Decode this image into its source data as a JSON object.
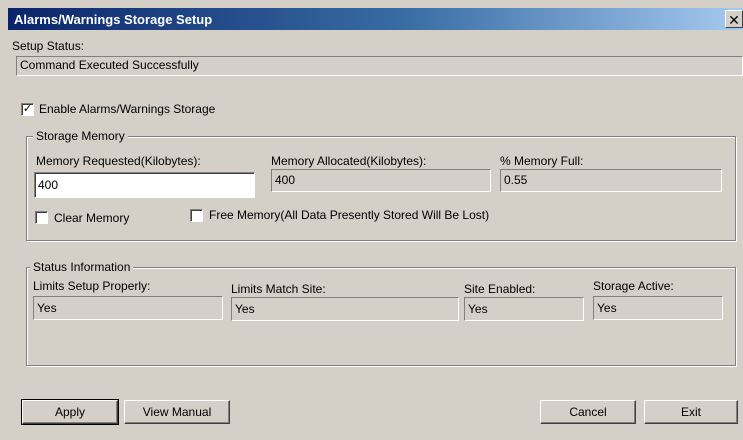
{
  "window": {
    "title": "Alarms/Warnings Storage Setup",
    "close_glyph": "✕"
  },
  "setup_status": {
    "label": "Setup Status:",
    "value": "Command Executed Successfully"
  },
  "enable_storage": {
    "label": "Enable Alarms/Warnings Storage",
    "checked": true,
    "check_glyph": "✓"
  },
  "storage_memory": {
    "group_title": "Storage Memory",
    "requested": {
      "label": "Memory Requested(Kilobytes):",
      "value": "400"
    },
    "allocated": {
      "label": "Memory Allocated(Kilobytes):",
      "value": "400"
    },
    "full": {
      "label": "% Memory Full:",
      "value": "0.55"
    },
    "clear_memory": {
      "label": "Clear Memory",
      "checked": false
    },
    "free_memory": {
      "label": "Free Memory(All Data Presently Stored Will Be Lost)",
      "checked": false
    }
  },
  "status_information": {
    "group_title": "Status Information",
    "limits_setup": {
      "label": "Limits Setup Properly:",
      "value": "Yes"
    },
    "limits_match": {
      "label": "Limits Match Site:",
      "value": "Yes"
    },
    "site_enabled": {
      "label": "Site Enabled:",
      "value": "Yes"
    },
    "storage_active": {
      "label": "Storage Active:",
      "value": "Yes"
    }
  },
  "buttons": {
    "apply": "Apply",
    "view_manual": "View Manual",
    "cancel": "Cancel",
    "exit": "Exit"
  }
}
